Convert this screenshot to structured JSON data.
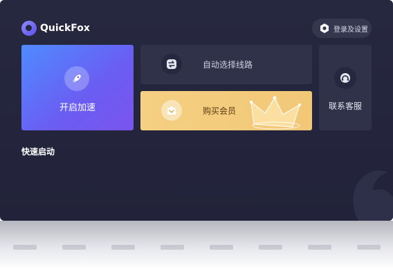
{
  "brand": {
    "name": "QuickFox"
  },
  "header": {
    "settings_label": "登录及设置"
  },
  "cards": {
    "start": {
      "label": "开启加速"
    },
    "route": {
      "label": "自动选择线路"
    },
    "vip": {
      "label": "购买会员"
    },
    "service": {
      "label": "联系客服"
    }
  },
  "quick_launch": {
    "title": "快速启动"
  },
  "colors": {
    "background": "#262840",
    "card": "#30324a",
    "accent_start": "#4f8bff",
    "accent_end": "#7a55ee",
    "vip_gold": "#f5cf82"
  },
  "icons": {
    "logo": "quickfox-logo-icon",
    "settings": "hexagon-settings-icon",
    "start": "rocket-icon",
    "route": "swap-route-icon",
    "vip": "gift-bag-icon",
    "service": "headset-icon"
  }
}
